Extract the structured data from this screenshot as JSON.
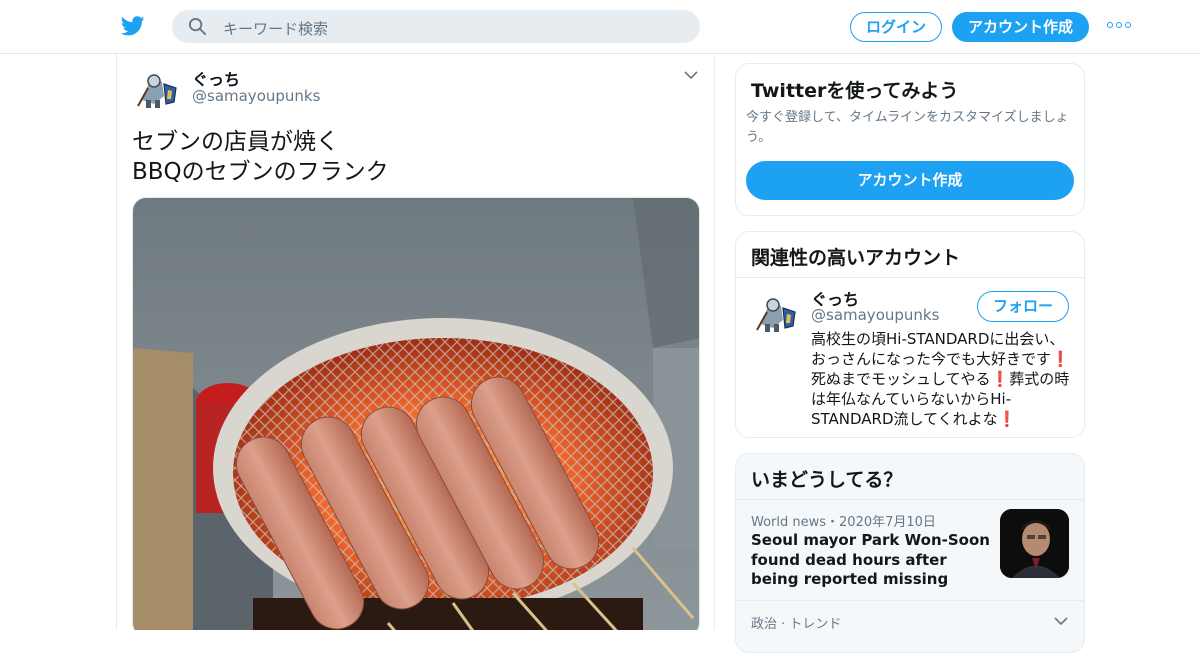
{
  "header": {
    "search_placeholder": "キーワード検索",
    "login_label": "ログイン",
    "signup_label": "アカウント作成"
  },
  "tweet": {
    "name": "ぐっち",
    "handle": "@samayoupunks",
    "text_line1": "セブンの店員が焼く",
    "text_line2": "BBQのセブンのフランク"
  },
  "signup_card": {
    "title": "Twitterを使ってみよう",
    "subtitle": "今すぐ登録して、タイムラインをカスタマイズしましょう。",
    "button_label": "アカウント作成"
  },
  "related_card": {
    "title": "関連性の高いアカウント",
    "name": "ぐっち",
    "handle": "@samayoupunks",
    "follow_label": "フォロー",
    "bio": "高校生の頃Hi-STANDARDに出会い、おっさんになった今でも大好きです❗️ 死ぬまでモッシュしてやる❗️葬式の時は年仏なんていらないからHi-STANDARD流してくれよな❗️"
  },
  "trends_card": {
    "title": "いまどうしてる？",
    "trend1_meta": "World news・2020年7月10日",
    "trend1_title": "Seoul mayor Park Won-Soon found dead hours after being reported missing",
    "trend2_meta": "政治 · トレンド"
  },
  "colors": {
    "accent": "#1da1f2",
    "muted_text": "#657786",
    "border": "#e6ecf0"
  },
  "icons": [
    "twitter-bird-icon",
    "search-icon",
    "more-icon",
    "chevron-down-icon"
  ]
}
